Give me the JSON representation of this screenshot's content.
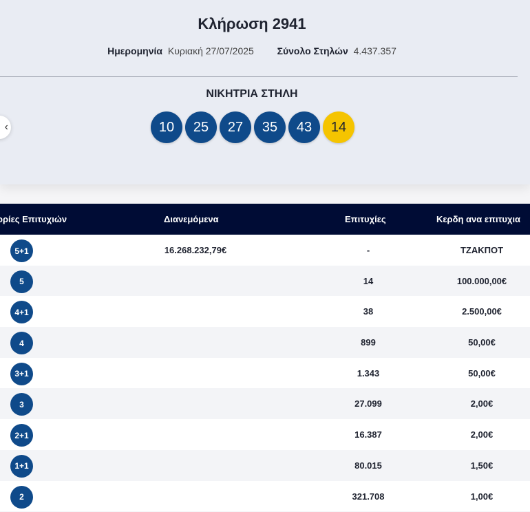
{
  "draw": {
    "title": "Κλήρωση 2941",
    "date_label": "Ημερομηνία",
    "date_value": "Κυριακή 27/07/2025",
    "total_label": "Σύνολο Στηλών",
    "total_value": "4.437.357",
    "winning_label": "ΝΙΚΗΤΡΙΑ ΣΤΗΛΗ",
    "numbers": [
      "10",
      "25",
      "27",
      "35",
      "43"
    ],
    "joker": "14"
  },
  "nav": {
    "prev_glyph": "‹"
  },
  "colors": {
    "ball": "#0f4a8a",
    "joker": "#f5c400",
    "table_header": "#000c35"
  },
  "table": {
    "headers": {
      "category": "ορίες Επιτυχιών",
      "distributed": "Διανεμόμενα",
      "winners": "Επιτυχίες",
      "prize": "Κερδη ανα επιτυχια"
    },
    "rows": [
      {
        "category": "5+1",
        "distributed": "16.268.232,79€",
        "winners": "-",
        "prize": "ΤΖΑΚΠΟΤ"
      },
      {
        "category": "5",
        "distributed": "",
        "winners": "14",
        "prize": "100.000,00€"
      },
      {
        "category": "4+1",
        "distributed": "",
        "winners": "38",
        "prize": "2.500,00€"
      },
      {
        "category": "4",
        "distributed": "",
        "winners": "899",
        "prize": "50,00€"
      },
      {
        "category": "3+1",
        "distributed": "",
        "winners": "1.343",
        "prize": "50,00€"
      },
      {
        "category": "3",
        "distributed": "",
        "winners": "27.099",
        "prize": "2,00€"
      },
      {
        "category": "2+1",
        "distributed": "",
        "winners": "16.387",
        "prize": "2,00€"
      },
      {
        "category": "1+1",
        "distributed": "",
        "winners": "80.015",
        "prize": "1,50€"
      },
      {
        "category": "2",
        "distributed": "",
        "winners": "321.708",
        "prize": "1,00€"
      }
    ]
  }
}
